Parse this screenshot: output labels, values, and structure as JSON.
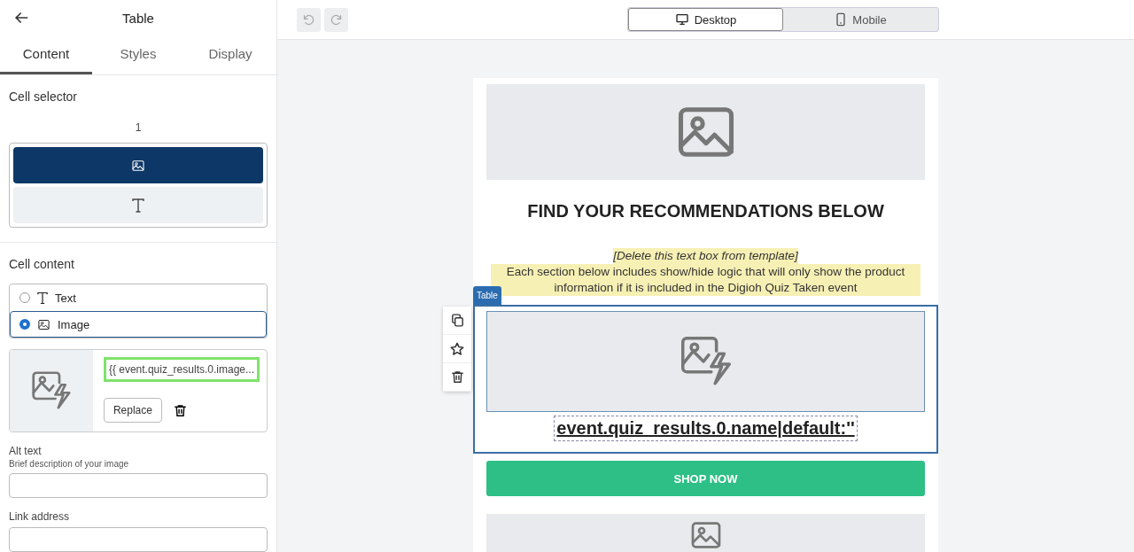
{
  "panel": {
    "title": "Table",
    "tabs": [
      {
        "label": "Content",
        "selected": true
      },
      {
        "label": "Styles",
        "selected": false
      },
      {
        "label": "Display",
        "selected": false
      }
    ],
    "cell_selector": {
      "label": "Cell selector",
      "column": "1",
      "cells": [
        {
          "kind": "image",
          "selected": true
        },
        {
          "kind": "text",
          "selected": false
        }
      ]
    },
    "cell_content": {
      "label": "Cell content",
      "options": [
        {
          "kind": "text",
          "label": "Text",
          "selected": false
        },
        {
          "kind": "image",
          "label": "Image",
          "selected": true
        }
      ]
    },
    "image": {
      "url": "{{ event.quiz_results.0.image...",
      "replace": "Replace"
    },
    "alt_text": {
      "label": "Alt text",
      "hint": "Brief description of your image"
    },
    "link": {
      "label": "Link address"
    }
  },
  "view_toggle": [
    {
      "kind": "desktop",
      "label": "Desktop",
      "selected": true
    },
    {
      "kind": "mobile",
      "label": "Mobile",
      "selected": false
    }
  ],
  "email": {
    "blocks": [
      {
        "kind": "image"
      },
      {
        "kind": "heading",
        "text": "FIND YOUR RECOMMENDATIONS BELOW"
      },
      {
        "kind": "note",
        "title": "[Delete this text box from template]",
        "text": "Each section below includes show/hide logic that will only show the product information if it is included in the Digioh Quiz Taken event"
      },
      {
        "kind": "table",
        "tag": "Table",
        "text": "event.quiz_results.0.name|default:''"
      },
      {
        "kind": "button",
        "text": "SHOP NOW"
      },
      {
        "kind": "image"
      }
    ]
  }
}
